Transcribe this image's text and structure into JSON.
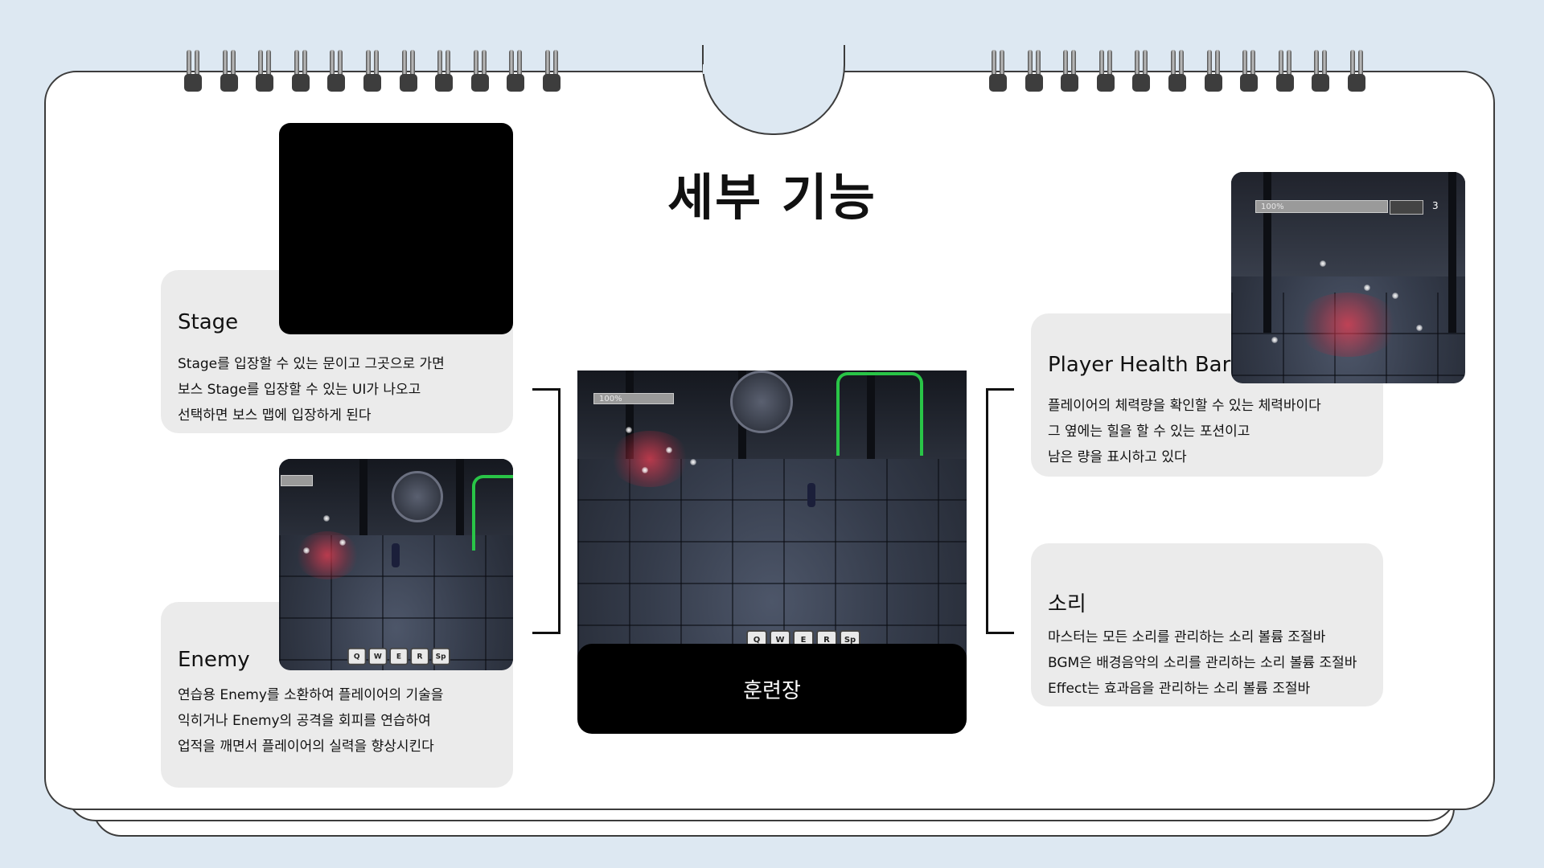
{
  "page": {
    "title": "세부 기능"
  },
  "cards": {
    "stage": {
      "heading": "Stage",
      "lines": [
        "Stage를 입장할 수 있는 문이고 그곳으로 가면",
        "보스 Stage를 입장할 수 있는 UI가 나오고",
        "선택하면 보스 맵에 입장하게 된다"
      ]
    },
    "enemy": {
      "heading": "Enemy",
      "lines": [
        "연습용 Enemy를 소환하여 플레이어의 기술을",
        "익히거나 Enemy의 공격을 회피를 연습하여",
        "업적을 깨면서 플레이어의 실력을 향상시킨다"
      ]
    },
    "health": {
      "heading": "Player Health Bar",
      "lines": [
        "플레이어의 체력량을 확인할 수 있는 체력바이다",
        "그 옆에는 힐을 할 수 있는 포션이고",
        "남은 량을 표시하고 있다"
      ]
    },
    "sound": {
      "heading": "소리",
      "lines": [
        "마스터는 모든 소리를 관리하는 소리 볼륨 조절바",
        "BGM은 배경음악의 소리를 관리하는 소리 볼륨 조절바",
        "Effect는 효과음을 관리하는 소리 볼륨 조절바"
      ]
    }
  },
  "center": {
    "caption": "훈련장"
  },
  "hud": {
    "hp_label": "100%",
    "potion_count": "3",
    "keys": [
      "Q",
      "W",
      "E",
      "R",
      "Sp"
    ]
  },
  "colors": {
    "background": "#dde8f2",
    "card": "#ebebeb",
    "caption_bg": "#000000",
    "door_glow": "#29c547"
  }
}
